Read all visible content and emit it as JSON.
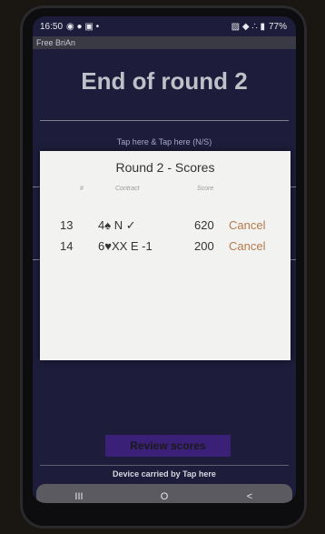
{
  "statusbar": {
    "time": "16:50",
    "left_icons": "◉ ● ▣ •",
    "battery": "77%",
    "right_icons": "▨ ◆ ∴ ▮"
  },
  "app": {
    "name": "Free BriAn"
  },
  "headline": "End of round 2",
  "tap_hint": "Tap here & Tap here (N/S)",
  "dialog": {
    "title": "Round 2 - Scores",
    "columns": {
      "board": "#",
      "contract": "Contract",
      "score": "Score"
    },
    "rows": [
      {
        "board": "13",
        "contract": "4♠ N ✓",
        "score": "620",
        "action": "Cancel"
      },
      {
        "board": "14",
        "contract": "6♥XX E -1",
        "score": "200",
        "action": "Cancel"
      }
    ]
  },
  "buttons": {
    "review": "Review scores"
  },
  "footer": "Device carried by Tap here",
  "navbar": {
    "recent": "III",
    "home": "O",
    "back": "<"
  },
  "colors": {
    "background": "#1d1d3b",
    "dialog": "#f2f2f1",
    "cancel": "#b77a4a",
    "review_button": "#3a2076"
  }
}
